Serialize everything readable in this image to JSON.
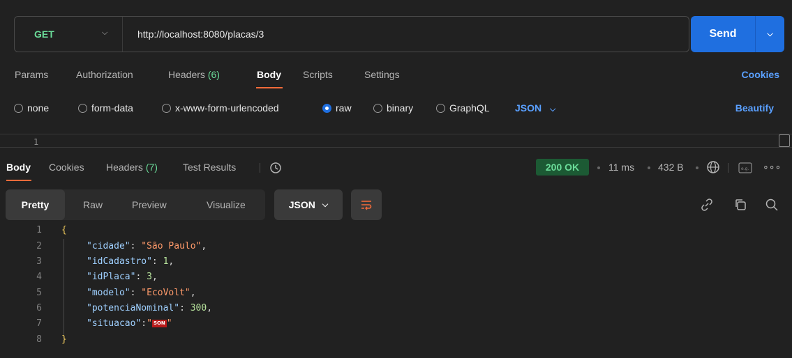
{
  "request": {
    "method": "GET",
    "url": "http://localhost:8080/placas/3",
    "send_label": "Send"
  },
  "request_tabs": {
    "params": "Params",
    "authorization": "Authorization",
    "headers": "Headers",
    "headers_count": "(6)",
    "body": "Body",
    "scripts": "Scripts",
    "settings": "Settings",
    "cookies": "Cookies"
  },
  "body_types": {
    "options": [
      "none",
      "form-data",
      "x-www-form-urlencoded",
      "raw",
      "binary",
      "GraphQL"
    ],
    "selected": "raw",
    "format": "JSON",
    "beautify": "Beautify",
    "editor_line": "1"
  },
  "response_tabs": {
    "body": "Body",
    "cookies": "Cookies",
    "headers": "Headers",
    "headers_count": "(7)",
    "test_results": "Test Results"
  },
  "response_meta": {
    "status": "200 OK",
    "time": "11 ms",
    "size": "432 B",
    "status_color": "#1c5a34"
  },
  "response_toolbar": {
    "pretty": "Pretty",
    "raw": "Raw",
    "preview": "Preview",
    "visualize": "Visualize",
    "format": "JSON"
  },
  "response_body": {
    "line_numbers": [
      "1",
      "2",
      "3",
      "4",
      "5",
      "6",
      "7",
      "8"
    ],
    "open_brace": "{",
    "close_brace": "}",
    "fields": [
      {
        "key": "\"cidade\"",
        "value": "\"São Paulo\"",
        "kind": "str"
      },
      {
        "key": "\"idCadastro\"",
        "value": "1",
        "kind": "num"
      },
      {
        "key": "\"idPlaca\"",
        "value": "3",
        "kind": "num"
      },
      {
        "key": "\"modelo\"",
        "value": "\"EcoVolt\"",
        "kind": "str"
      },
      {
        "key": "\"potenciaNominal\"",
        "value": "300",
        "kind": "num"
      },
      {
        "key": "\"situacao\"",
        "value": "SON",
        "kind": "invalid"
      }
    ]
  },
  "colors": {
    "accent": "#1f6fe0",
    "tab_underline": "#f26b3a",
    "method": "#6bdd9a",
    "link": "#5aa0ff"
  }
}
